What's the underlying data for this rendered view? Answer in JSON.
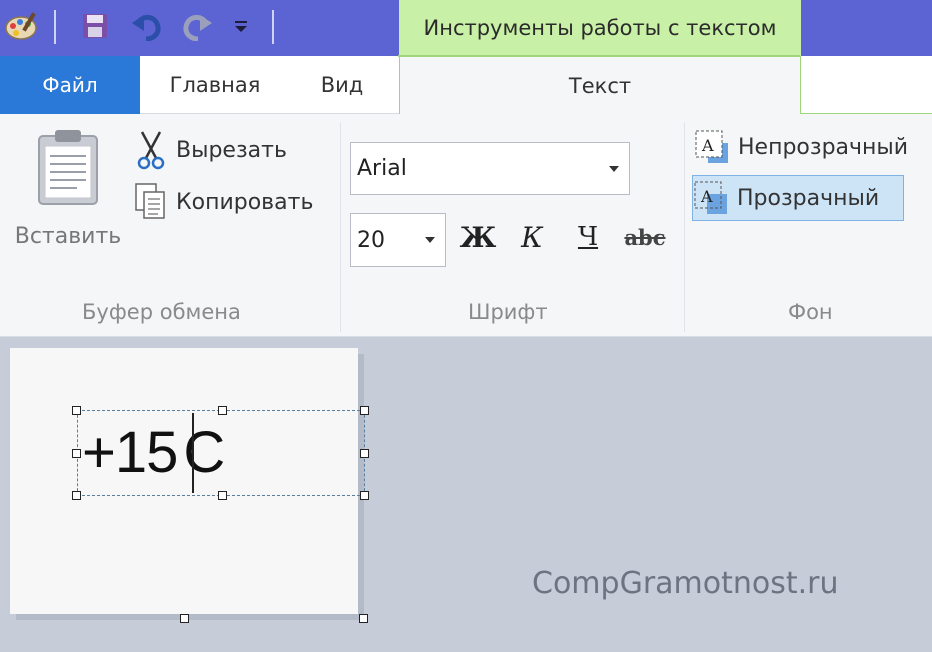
{
  "window": {
    "context_tab_title": "Инструменты работы с текстом"
  },
  "quick_access": {
    "icons": [
      "paint-app-icon",
      "save-icon",
      "undo-icon",
      "redo-icon",
      "customize-dropdown-icon"
    ]
  },
  "tabs": {
    "file": "Файл",
    "home": "Главная",
    "view": "Вид",
    "text": "Текст"
  },
  "clipboard": {
    "paste": "Вставить",
    "cut": "Вырезать",
    "copy": "Копировать",
    "group_label": "Буфер обмена"
  },
  "font": {
    "family": "Arial",
    "size": "20",
    "bold": "Ж",
    "italic": "К",
    "underline": "Ч",
    "strikethrough": "abc",
    "group_label": "Шрифт"
  },
  "background": {
    "opaque": "Непрозрачный",
    "transparent": "Прозрачный",
    "selected": "Прозрачный",
    "group_label": "Фон"
  },
  "canvas": {
    "text_before_caret": "+15",
    "text_after_caret": "C"
  },
  "watermark": "CompGramotnost.ru",
  "colors": {
    "title_bar": "#5c63d3",
    "context_tab": "#c8f0a6",
    "file_tab": "#2a79d8",
    "ribbon": "#f5f6f7",
    "workspace": "#c6cdd8",
    "selected_option": "#cde4f7"
  }
}
